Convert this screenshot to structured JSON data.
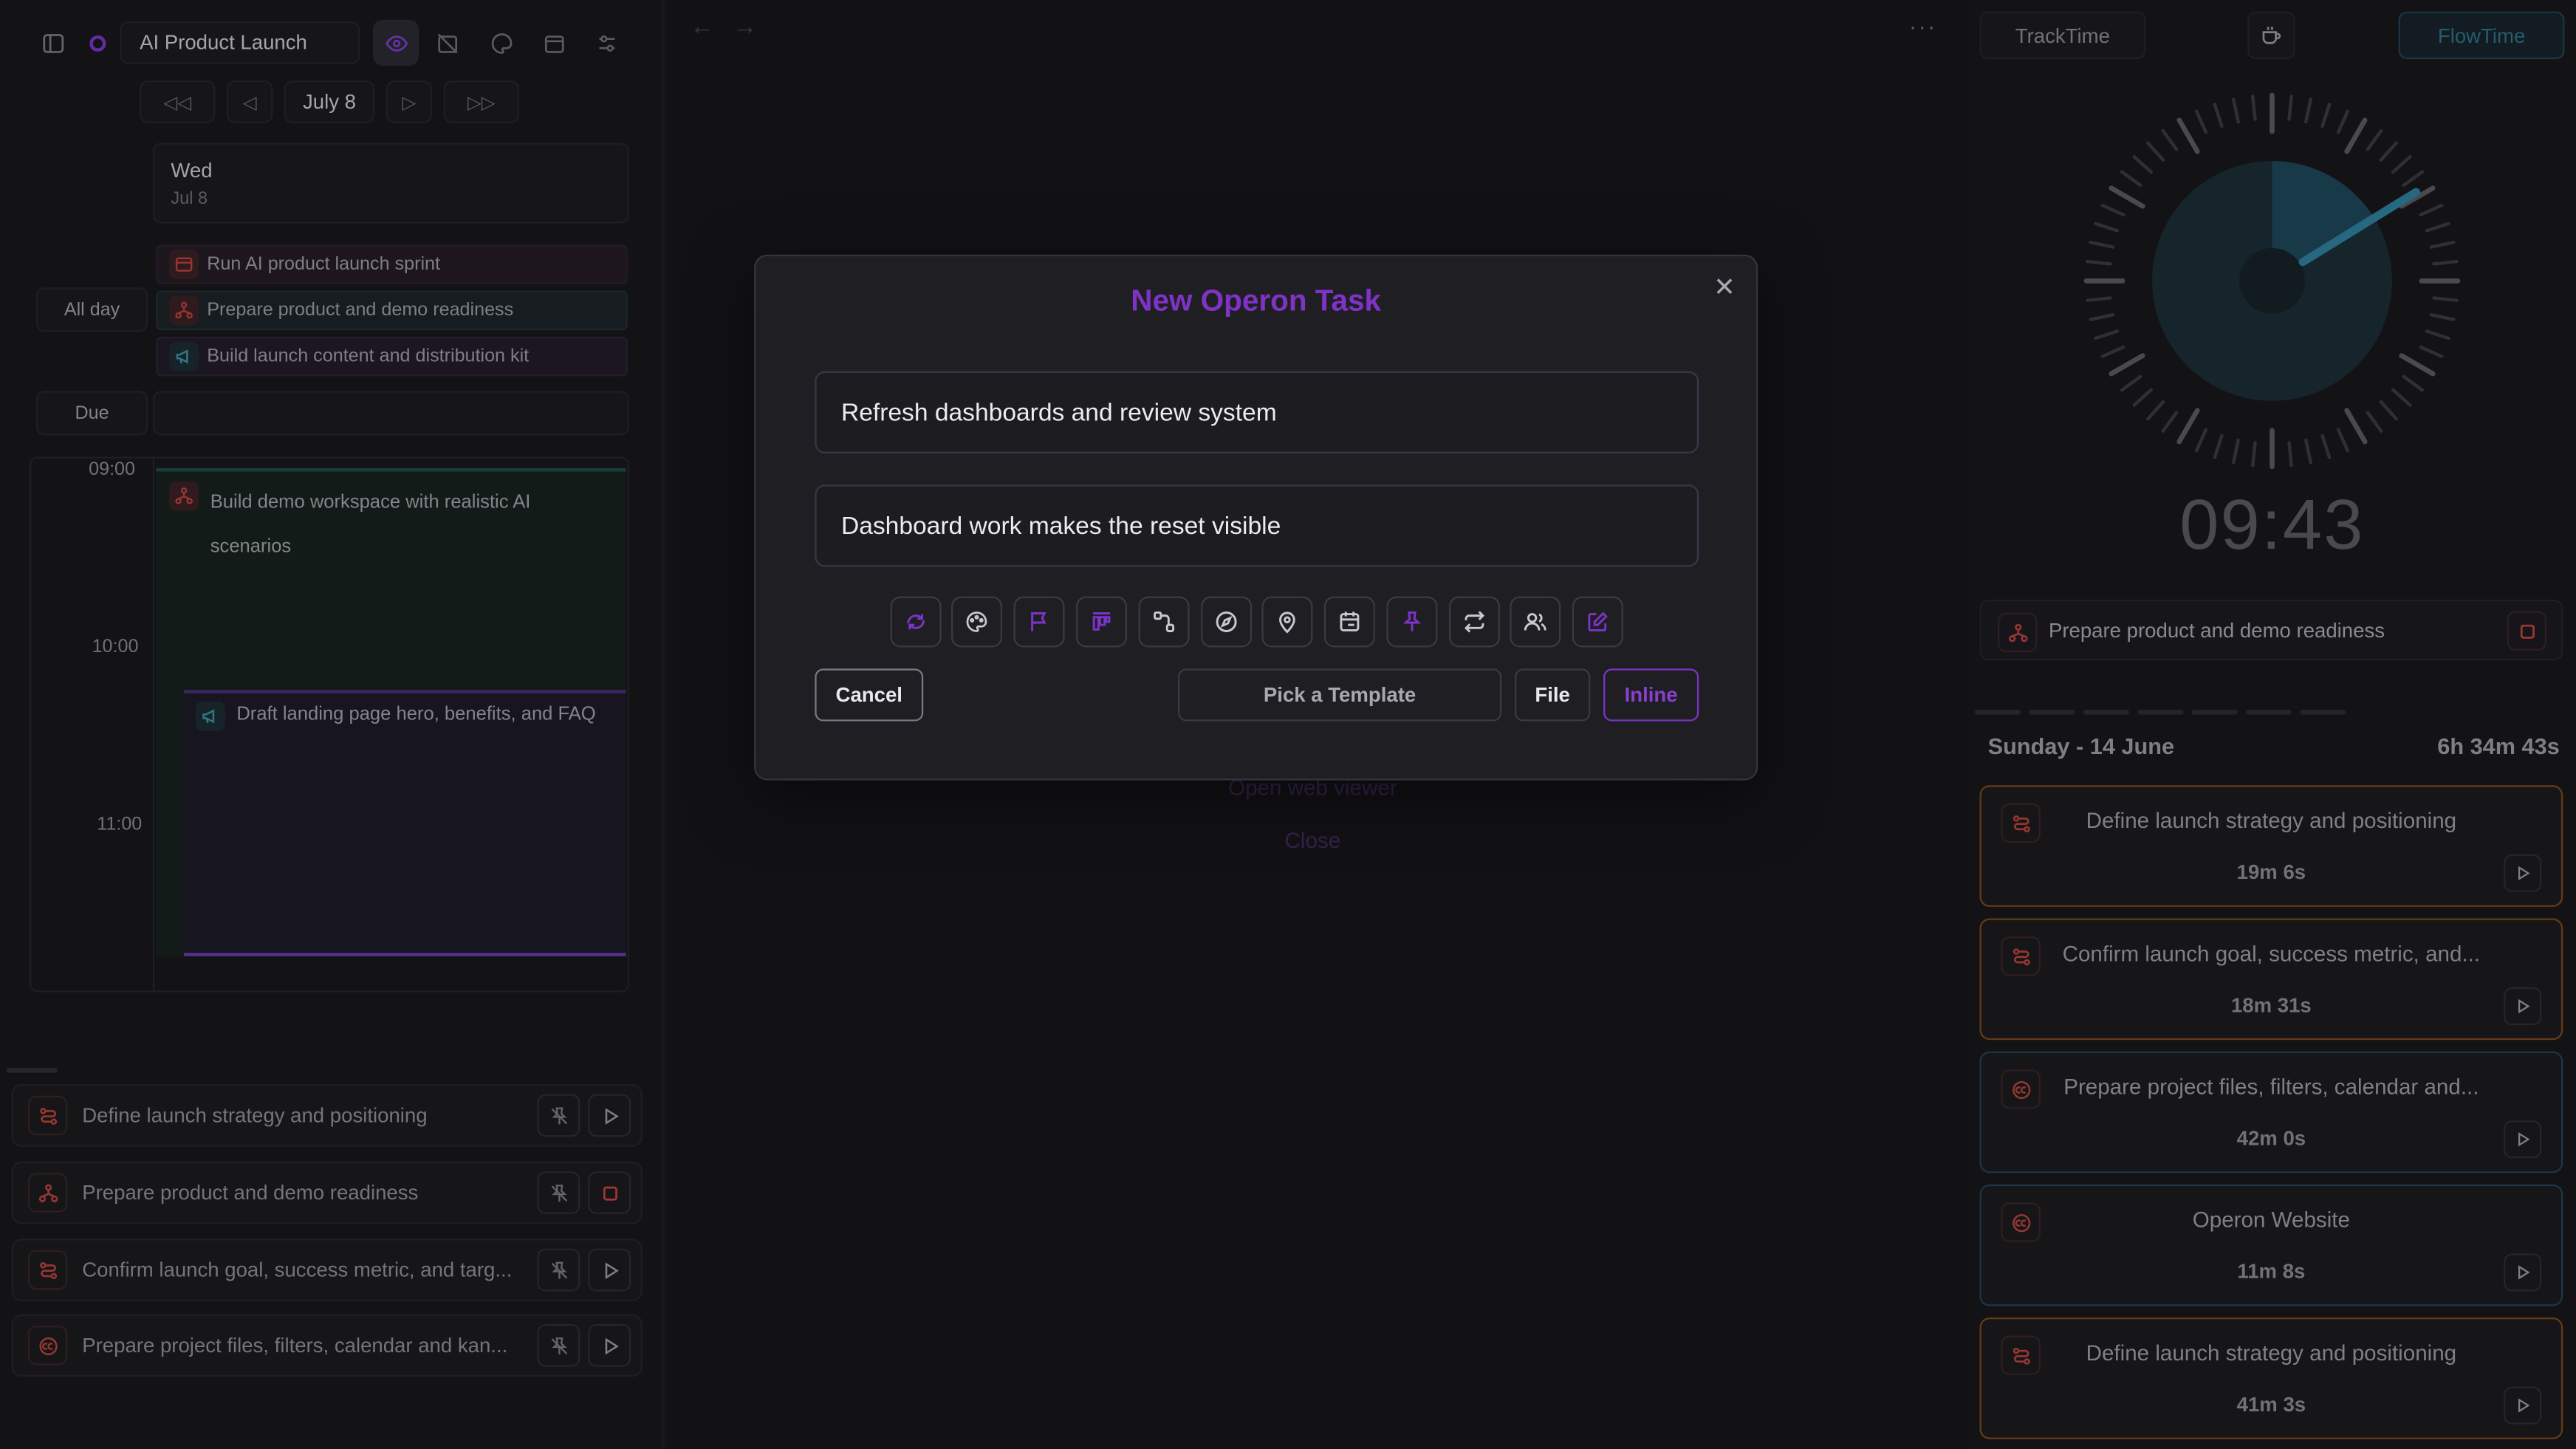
{
  "colors": {
    "accent": "#8a3fd0",
    "brand_danger": "#c2453f",
    "teal": "#1c4a5a",
    "orange_border": "#7a4a1c",
    "blue_border": "#224257"
  },
  "toolbar": {
    "project": "AI Product Launch"
  },
  "calendar": {
    "date_label": "July 8",
    "day_name": "Wed",
    "day_date": "Jul 8",
    "all_day_label": "All day",
    "due_label": "Due",
    "all_day_events": [
      {
        "label": "Run AI product launch sprint",
        "icon": "calendar-icon"
      },
      {
        "label": "Prepare product and demo readiness",
        "icon": "hierarchy-icon"
      },
      {
        "label": "Build launch content and distribution kit",
        "icon": "megaphone-icon"
      }
    ],
    "times": [
      "09:00",
      "10:00",
      "11:00"
    ],
    "blocks": [
      {
        "label": "Build demo workspace with realistic AI scenarios",
        "icon": "hierarchy-icon"
      },
      {
        "label": "Draft landing page hero, benefits, and FAQ",
        "icon": "megaphone-icon"
      }
    ]
  },
  "task_list": [
    {
      "label": "Define launch strategy and positioning",
      "icon": "route-icon",
      "action": "play"
    },
    {
      "label": "Prepare product and demo readiness",
      "icon": "hierarchy-icon",
      "action": "stop"
    },
    {
      "label": "Confirm launch goal, success metric, and targ...",
      "icon": "route-icon",
      "action": "play"
    },
    {
      "label": "Prepare project files, filters, calendar and kan...",
      "icon": "cc-icon",
      "action": "play"
    }
  ],
  "middle": {
    "open_web_viewer": "Open web viewer",
    "close": "Close"
  },
  "modal": {
    "title": "New Operon Task",
    "title_value": "Refresh dashboards and review system",
    "note_value": "Dashboard work makes the reset visible",
    "cancel": "Cancel",
    "pick_template": "Pick a Template",
    "file": "File",
    "inline": "Inline",
    "tools": [
      "loop-icon",
      "palette-icon",
      "flag-icon",
      "kanban-icon",
      "route-icon",
      "compass-icon",
      "location-pin-icon",
      "calendar-icon",
      "pin-icon",
      "repeat-icon",
      "users-icon",
      "edit-icon"
    ]
  },
  "timer": {
    "tab_track": "TrackTime",
    "tab_flow": "FlowTime",
    "time": "09:43",
    "dial_fraction": 0.162,
    "current_task": "Prepare product and demo readiness",
    "day_label": "Sunday - 14 June",
    "day_total": "6h 34m 43s",
    "entries": [
      {
        "title": "Define launch strategy and positioning",
        "duration": "19m 6s",
        "icon": "route-icon",
        "border": "orange"
      },
      {
        "title": "Confirm launch goal, success metric, and...",
        "duration": "18m 31s",
        "icon": "route-icon",
        "border": "orange"
      },
      {
        "title": "Prepare project files, filters, calendar and...",
        "duration": "42m 0s",
        "icon": "cc-icon",
        "border": "blue"
      },
      {
        "title": "Operon Website",
        "duration": "11m 8s",
        "icon": "cc-icon",
        "border": "blue"
      },
      {
        "title": "Define launch strategy and positioning",
        "duration": "41m 3s",
        "icon": "route-icon",
        "border": "orange"
      }
    ]
  }
}
